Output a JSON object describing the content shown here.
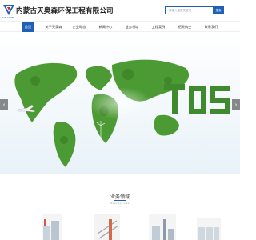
{
  "header": {
    "company_name": "内蒙古天奥森环保工程有限公司",
    "logo_subtext": "TIAN AO SEN",
    "search_placeholder": "请输入搜索关键词",
    "search_button": "搜索"
  },
  "nav": {
    "items": [
      {
        "label": "首页",
        "active": true
      },
      {
        "label": "关于天奥森",
        "active": false
      },
      {
        "label": "企业动态",
        "active": false
      },
      {
        "label": "新闻中心",
        "active": false
      },
      {
        "label": "业务领域",
        "active": false
      },
      {
        "label": "工程案例",
        "active": false
      },
      {
        "label": "招贤纳士",
        "active": false
      },
      {
        "label": "联系我们",
        "active": false
      }
    ]
  },
  "banner": {
    "letters": "TOS",
    "prev_glyph": "‹",
    "next_glyph": "›"
  },
  "section": {
    "title": "业务领域",
    "subtitle": "Business area"
  },
  "colors": {
    "brand_blue": "#1f5fb5",
    "sky": "#eef6fb",
    "grass": "#4c9a34"
  }
}
